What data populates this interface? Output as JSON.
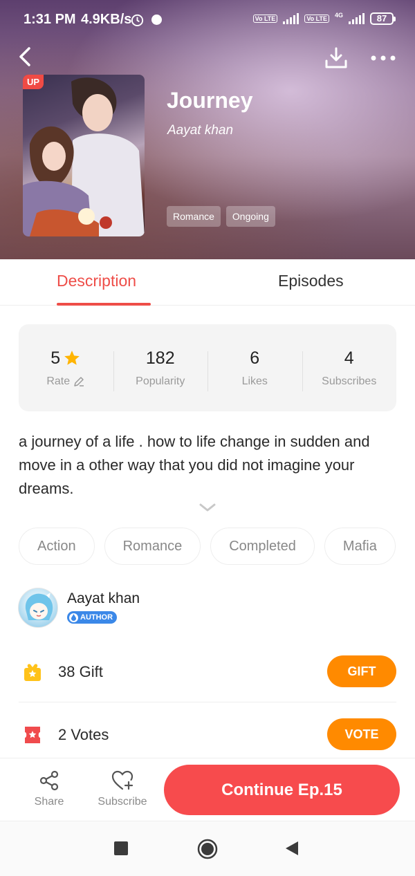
{
  "status_bar": {
    "time": "1:31 PM",
    "speed": "4.9KB/s",
    "volte1": "Vo LTE",
    "volte2": "Vo LTE",
    "network": "4G",
    "battery": "87"
  },
  "book": {
    "title": "Journey",
    "author": "Aayat khan",
    "cover_badge": "UP",
    "genres": [
      "Romance",
      "Ongoing"
    ]
  },
  "tabs": {
    "description": "Description",
    "episodes": "Episodes",
    "active": "Description"
  },
  "stats": [
    {
      "value": "5",
      "label": "Rate"
    },
    {
      "value": "182",
      "label": "Popularity"
    },
    {
      "value": "6",
      "label": "Likes"
    },
    {
      "value": "4",
      "label": "Subscribes"
    }
  ],
  "description": "a journey of a life . how to life change in sudden and move in a other way that you did not imagine your dreams.",
  "tags": [
    "Action",
    "Romance",
    "Completed",
    "Mafia"
  ],
  "author_section": {
    "name": "Aayat khan",
    "badge": "AUTHOR"
  },
  "gift": {
    "text": "38  Gift",
    "button": "GIFT"
  },
  "vote": {
    "text": "2  Votes",
    "button": "VOTE"
  },
  "bottom_bar": {
    "share": "Share",
    "subscribe": "Subscribe",
    "continue": "Continue Ep.15"
  },
  "colors": {
    "accent": "#ee4d48",
    "continue": "#f74b4d",
    "orange": "#ff8a00",
    "star": "#ffb400",
    "author_badge": "#3b88e8"
  }
}
